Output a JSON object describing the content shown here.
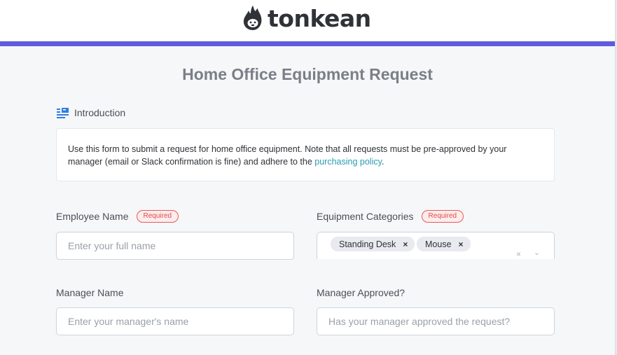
{
  "brand": {
    "name": "tonkean",
    "icon": "flame-monkey-logo-icon",
    "accent_color": "#5f5ae0"
  },
  "form": {
    "title": "Home Office Equipment Request",
    "section": {
      "label": "Introduction",
      "icon": "section-list-icon"
    },
    "intro": {
      "text_before_link": "Use this form to submit a request for home office equipment. Note that all requests must be pre-approved by your manager (email or Slack confirmation is fine) and adhere to the ",
      "link_text": "purchasing policy",
      "text_after_link": "."
    },
    "required_label": "Required",
    "fields": {
      "employee_name": {
        "label": "Employee Name",
        "required": true,
        "placeholder": "Enter your full name",
        "value": ""
      },
      "equipment_categories": {
        "label": "Equipment Categories",
        "required": true,
        "selected": [
          "Standing Desk",
          "Mouse"
        ],
        "remove_glyph": "×",
        "clear_glyph": "×",
        "dropdown_glyph": "⌄"
      },
      "manager_name": {
        "label": "Manager Name",
        "required": false,
        "placeholder": "Enter your manager's name",
        "value": ""
      },
      "manager_approved": {
        "label": "Manager Approved?",
        "required": false,
        "placeholder": "Has your manager approved the request?",
        "value": ""
      }
    }
  }
}
